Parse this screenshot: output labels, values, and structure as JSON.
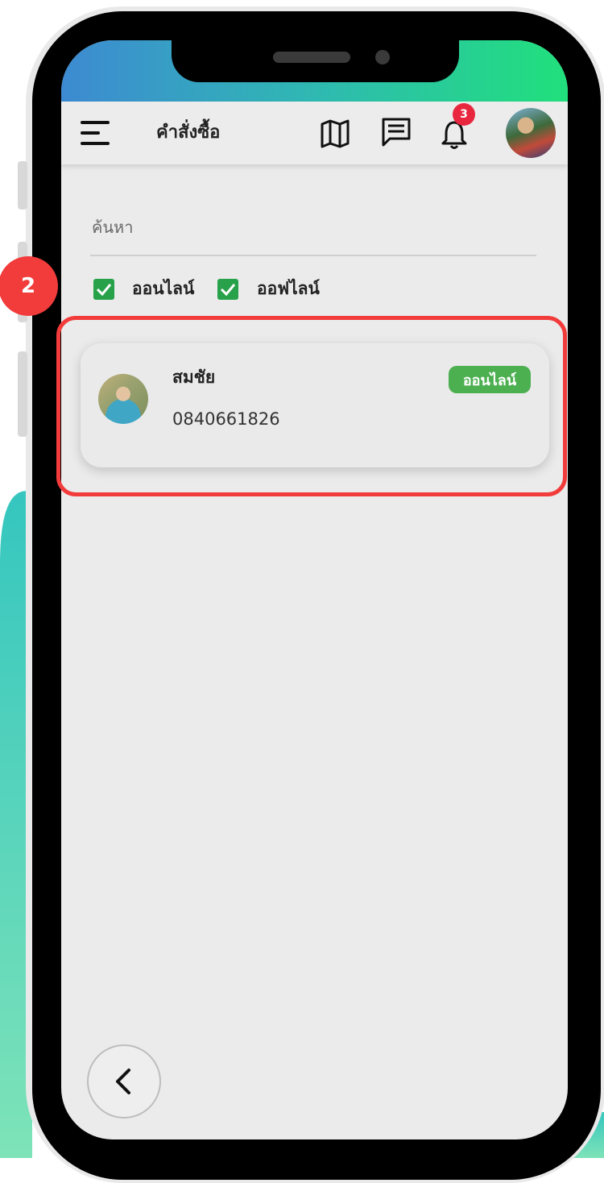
{
  "appbar": {
    "title": "คำสั่งซื้อ",
    "icons": [
      "menu-icon",
      "map-icon",
      "chat-icon",
      "bell-icon"
    ],
    "notification_count": "3"
  },
  "search": {
    "placeholder": "ค้นหา"
  },
  "filters": [
    {
      "label": "ออนไลน์",
      "checked": true
    },
    {
      "label": "ออฟไลน์",
      "checked": true
    }
  ],
  "customers": [
    {
      "name": "สมชัย",
      "phone": "0840661826",
      "status": "ออนไลน์"
    }
  ],
  "annotation": {
    "step_number": "2"
  },
  "colors": {
    "checkbox": "#27a14a",
    "status_online": "#4caf50",
    "badge": "#e8273f",
    "highlight": "#f23b3b"
  }
}
